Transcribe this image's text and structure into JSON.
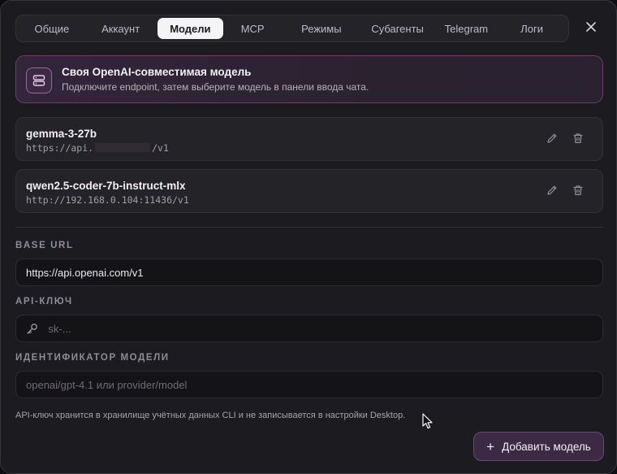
{
  "tabs": [
    {
      "label": "Общие",
      "active": false
    },
    {
      "label": "Аккаунт",
      "active": false
    },
    {
      "label": "Модели",
      "active": true
    },
    {
      "label": "MCP",
      "active": false
    },
    {
      "label": "Режимы",
      "active": false
    },
    {
      "label": "Субагенты",
      "active": false
    },
    {
      "label": "Telegram",
      "active": false
    },
    {
      "label": "Логи",
      "active": false
    }
  ],
  "close_icon": "close-icon",
  "banner": {
    "icon": "server-icon",
    "title": "Своя OpenAI-совместимая модель",
    "subtitle": "Подключите endpoint, затем выберите модель в панели ввода чата."
  },
  "models": [
    {
      "name": "gemma-3-27b",
      "url_prefix": "https://api.",
      "url_suffix": "/v1",
      "url_redacted": true
    },
    {
      "name": "qwen2.5-coder-7b-instruct-mlx",
      "url": "http://192.168.0.104:11436/v1",
      "url_redacted": false
    }
  ],
  "form": {
    "base_url_label": "BASE URL",
    "base_url_value": "https://api.openai.com/v1",
    "api_key_label": "API-КЛЮЧ",
    "api_key_placeholder": "sk-...",
    "model_id_label": "ИДЕНТИФИКАТОР МОДЕЛИ",
    "model_id_placeholder": "openai/gpt-4.1 или provider/model"
  },
  "note": "API-ключ хранится в хранилище учётных данных CLI и не записывается в настройки Desktop.",
  "add_button": {
    "label": "Добавить модель",
    "icon": "plus-icon"
  },
  "colors": {
    "accent": "#6d4775",
    "background": "#1c1b1f",
    "active_tab": "#f4f3f6"
  }
}
